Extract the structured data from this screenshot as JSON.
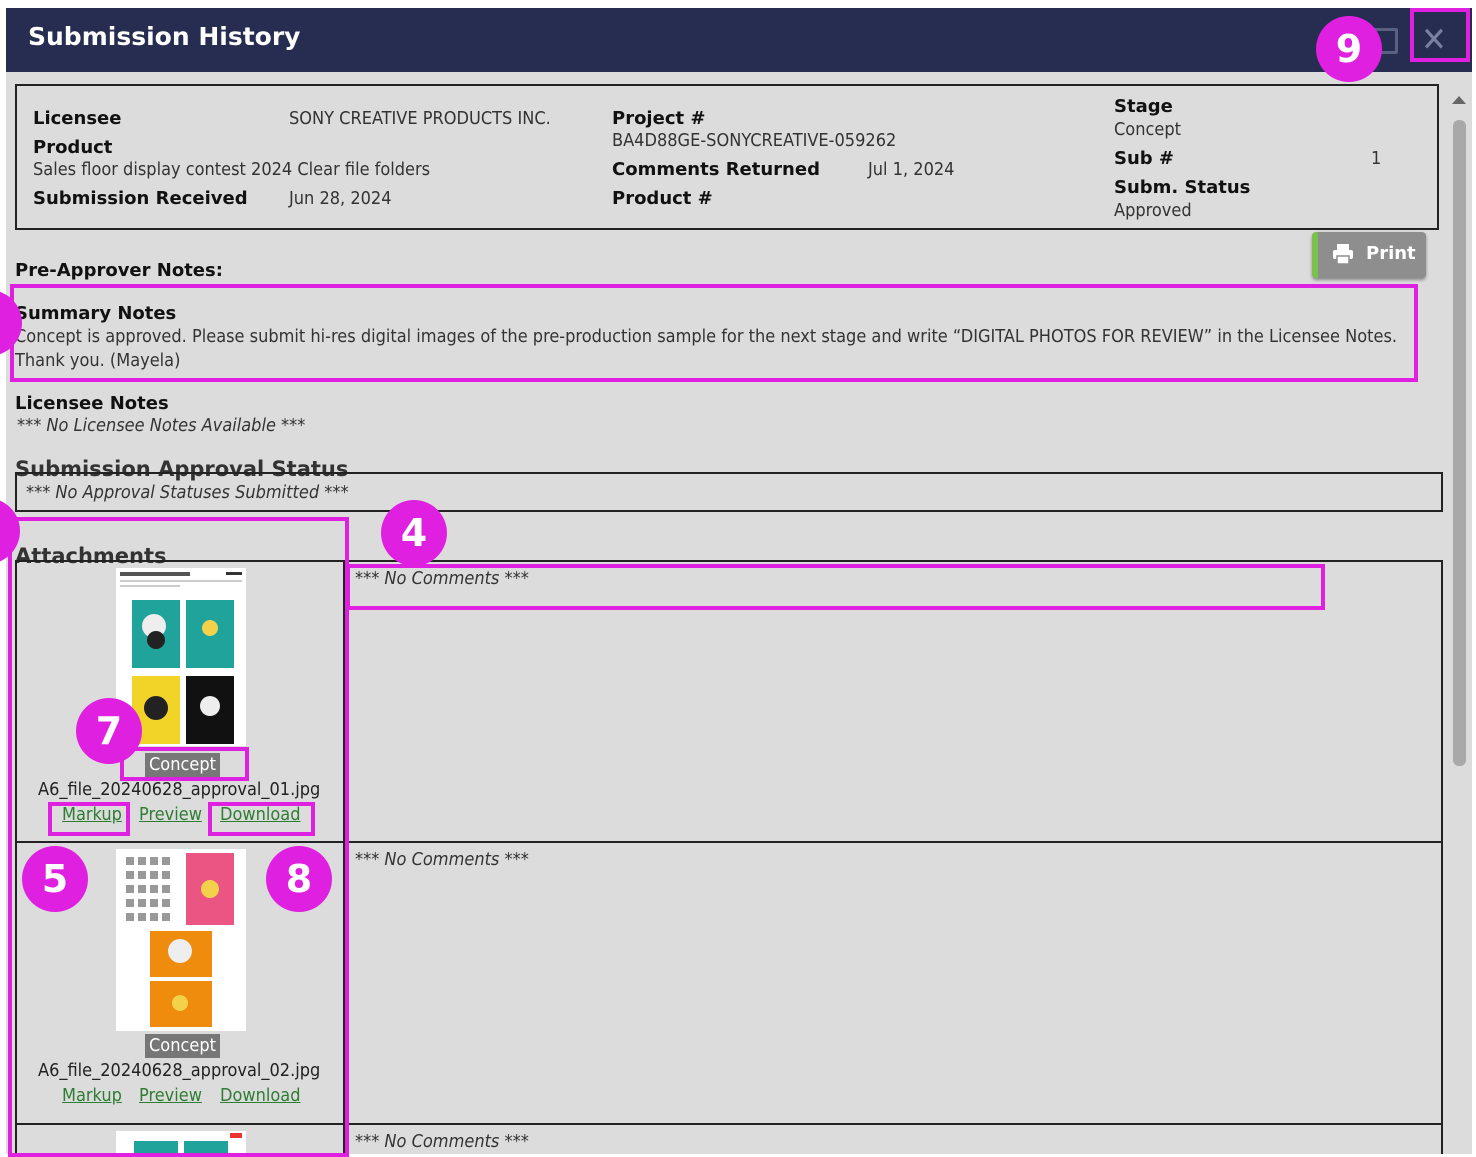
{
  "window": {
    "title": "Submission History"
  },
  "info": {
    "licensee_label": "Licensee",
    "licensee_value": "SONY CREATIVE PRODUCTS INC.",
    "product_label": "Product",
    "product_value": "Sales floor display contest 2024 Clear file folders",
    "received_label": "Submission Received",
    "received_value": "Jun 28, 2024",
    "project_label": "Project #",
    "project_value": "BA4D88GE-SONYCREATIVE-059262",
    "comments_label": "Comments Returned",
    "comments_value": "Jul 1, 2024",
    "productnum_label": "Product #",
    "stage_label": "Stage",
    "stage_value": "Concept",
    "sub_label": "Sub #",
    "sub_value": "1",
    "status_label": "Subm. Status",
    "status_value": "Approved"
  },
  "print_label": "Print",
  "preapprover_label": "Pre-Approver Notes:",
  "summary": {
    "title": "Summary Notes",
    "text": "Concept is approved. Please submit hi-res digital images of the pre-production sample for the next stage and write “DIGITAL PHOTOS FOR REVIEW” in the Licensee Notes. Thank you. (Mayela)"
  },
  "licensee_notes": {
    "title": "Licensee Notes",
    "text": "*** No Licensee Notes Available ***"
  },
  "approval_status": {
    "title": "Submission Approval Status",
    "text": "*** No Approval Statuses Submitted ***"
  },
  "attachments": {
    "title": "Attachments",
    "items": [
      {
        "stage": "Concept",
        "filename": "A6_file_20240628_approval_01.jpg",
        "markup": "Markup",
        "preview": "Preview",
        "download": "Download",
        "comments": "*** No Comments ***"
      },
      {
        "stage": "Concept",
        "filename": "A6_file_20240628_approval_02.jpg",
        "markup": "Markup",
        "preview": "Preview",
        "download": "Download",
        "comments": "*** No Comments ***"
      },
      {
        "comments": "*** No Comments ***"
      }
    ]
  },
  "badges": {
    "b4": "4",
    "b5": "5",
    "b7": "7",
    "b8": "8",
    "b9": "9"
  },
  "colors": {
    "titlebar": "#262d51",
    "highlight": "#e020e0",
    "link": "#2e7d32",
    "panel": "#dcdcdc"
  }
}
